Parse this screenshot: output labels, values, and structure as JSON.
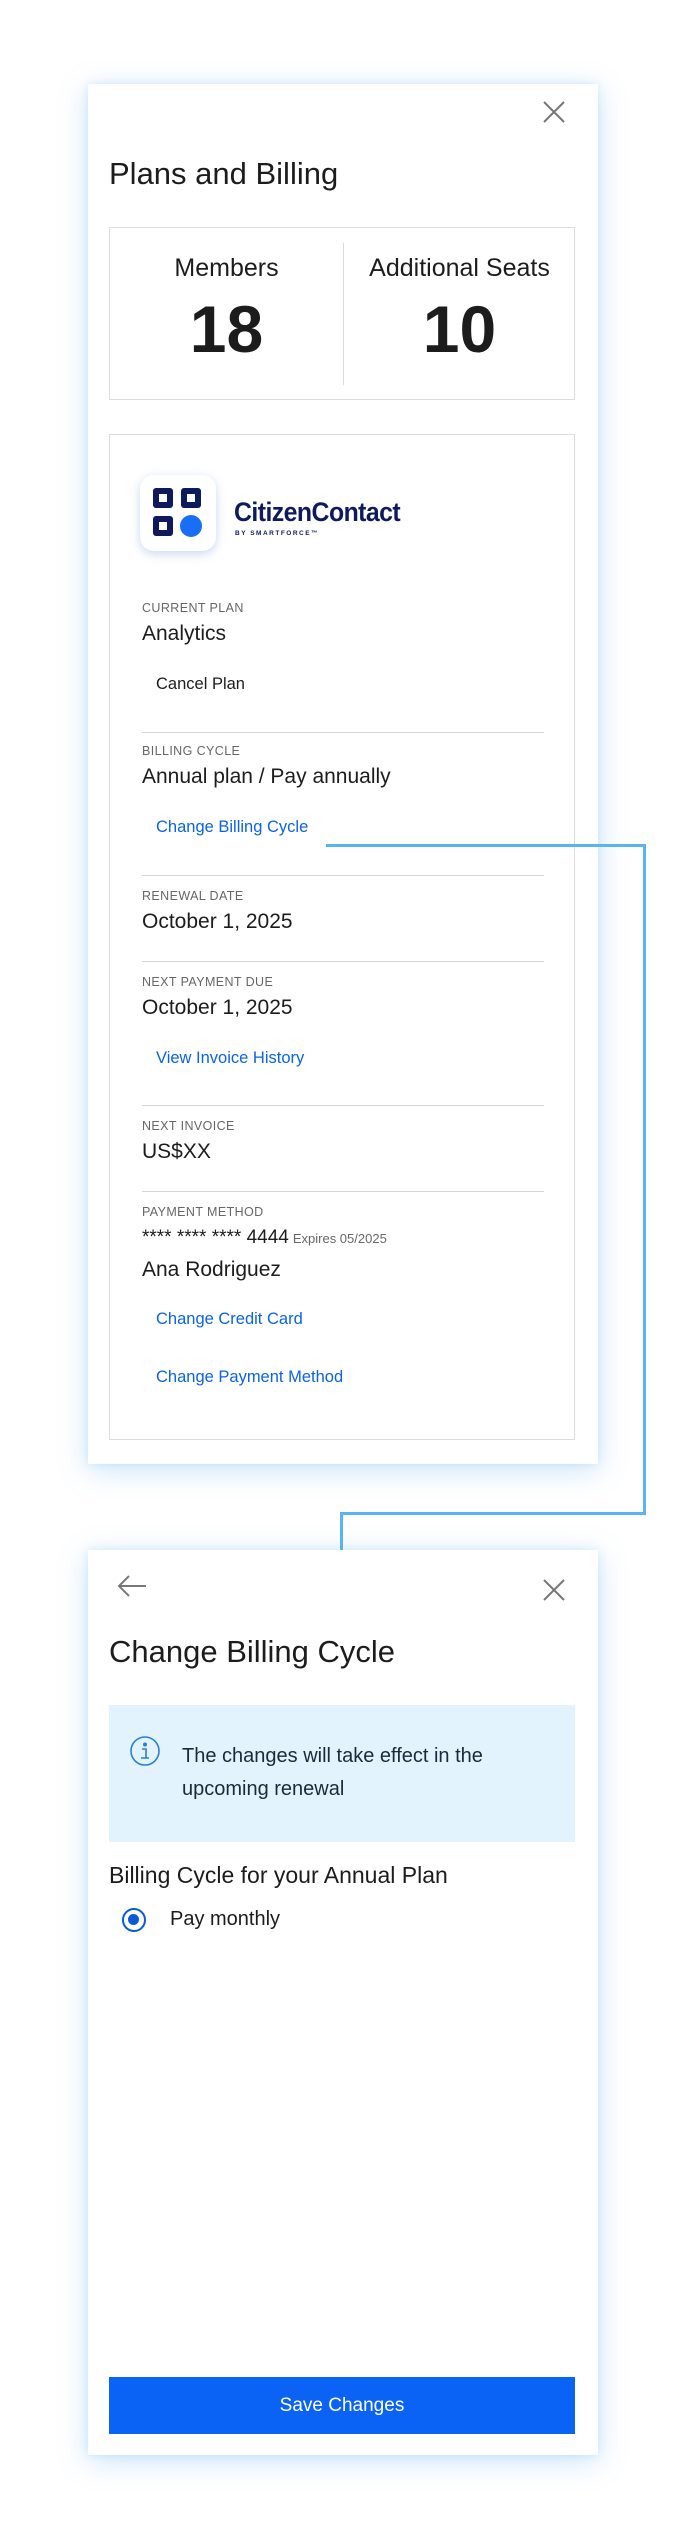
{
  "billing_panel": {
    "title": "Plans and Billing",
    "close_icon": "close-icon",
    "stats": {
      "members_label": "Members",
      "members_value": "18",
      "seats_label": "Additional Seats",
      "seats_value": "10"
    },
    "logo": {
      "name": "CitizenContact",
      "tagline": "BY SMARTFORCE™",
      "brand_color": "#0e1a5e",
      "accent_color": "#1a6ef5"
    },
    "current_plan": {
      "label": "CURRENT PLAN",
      "value": "Analytics",
      "action": "Cancel Plan"
    },
    "billing_cycle": {
      "label": "BILLING CYCLE",
      "value": "Annual plan / Pay annually",
      "action": "Change Billing Cycle"
    },
    "renewal_date": {
      "label": "RENEWAL DATE",
      "value": "October 1, 2025"
    },
    "next_payment": {
      "label": "NEXT PAYMENT DUE",
      "value": "October 1, 2025",
      "action": "View Invoice History"
    },
    "next_invoice": {
      "label": "NEXT INVOICE",
      "value": "US$XX"
    },
    "payment_method": {
      "label": "PAYMENT METHOD",
      "card_number": "**** **** **** 4444",
      "expires": "Expires 05/2025",
      "holder": "Ana Rodriguez",
      "change_card_action": "Change Credit Card",
      "change_method_action": "Change Payment Method"
    }
  },
  "cycle_panel": {
    "back_icon": "arrow-left-icon",
    "close_icon": "close-icon",
    "title": "Change Billing Cycle",
    "info_icon": "info-icon",
    "info_text": "The changes will take effect in the upcoming renewal",
    "section_title": "Billing Cycle for your Annual Plan",
    "option_label": "Pay monthly",
    "option_selected": true,
    "save_label": "Save Changes"
  },
  "colors": {
    "link": "#0b63e5",
    "primary_button": "#0b63f6",
    "info_background": "#e3f3fd",
    "connector": "#5ab4f4"
  }
}
